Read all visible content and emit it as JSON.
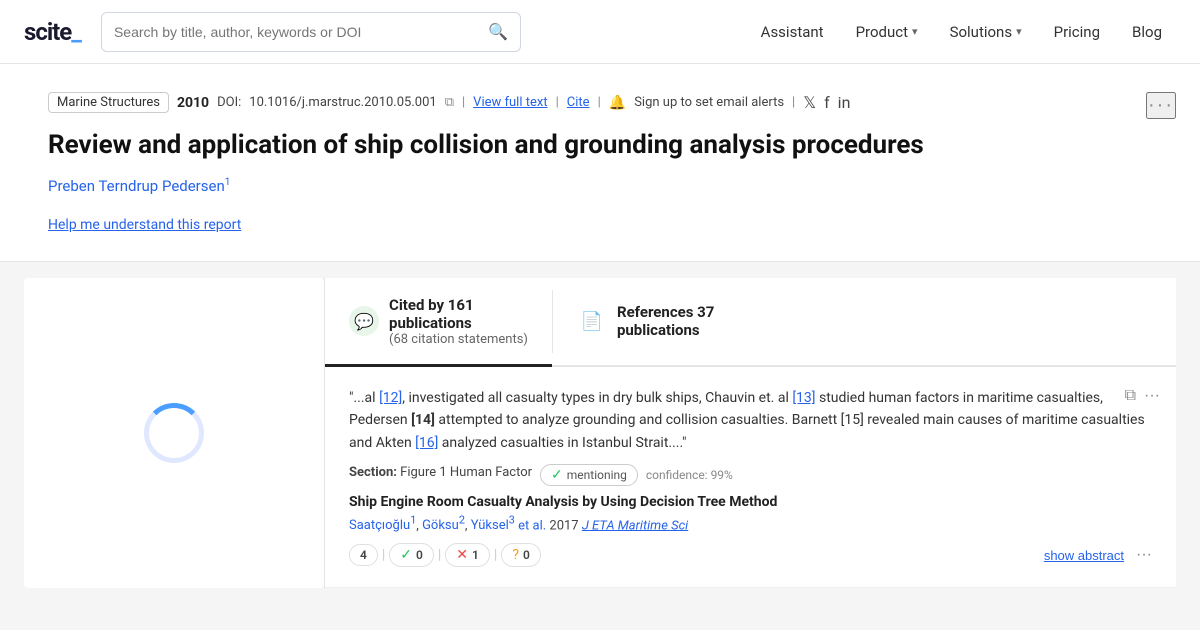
{
  "header": {
    "logo_text": "scite_",
    "search_placeholder": "Search by title, author, keywords or DOI",
    "nav_items": [
      {
        "label": "Assistant",
        "has_chevron": false
      },
      {
        "label": "Product",
        "has_chevron": true
      },
      {
        "label": "Solutions",
        "has_chevron": true
      },
      {
        "label": "Pricing",
        "has_chevron": false
      },
      {
        "label": "Blog",
        "has_chevron": false
      }
    ]
  },
  "article": {
    "journal": "Marine Structures",
    "year": "2010",
    "doi_label": "DOI:",
    "doi_value": "10.1016/j.marstruc.2010.05.001",
    "view_full_text": "View full text",
    "cite": "Cite",
    "signup_text": "Sign up to set email alerts",
    "title": "Review and application of ship collision and grounding analysis procedures",
    "author": "Preben Terndrup Pedersen",
    "author_superscript": "1",
    "help_link": "Help me understand this report",
    "more_label": "···"
  },
  "tabs": [
    {
      "id": "cited",
      "icon": "💬",
      "count": "Cited by 161",
      "label": "publications",
      "sub": "(68 citation statements)",
      "active": true
    },
    {
      "id": "references",
      "icon": "📄",
      "count": "References 37",
      "label": "publications",
      "sub": "",
      "active": false
    }
  ],
  "citation_card": {
    "text": "\"...al [12], investigated all casualty types in dry bulk ships, Chauvin et. al [13] studied human factors in maritime casualties, Pedersen [14] attempted to analyze grounding and collision casualties. Barnett [15] revealed main causes of maritime casualties and Akten [16] analyzed casualties in Istanbul Strait....\"",
    "refs": [
      "[12]",
      "[13]",
      "[14]",
      "[15]",
      "[16]"
    ],
    "section_label": "Section:",
    "section_value": "Figure 1 Human Factor",
    "mention_type": "mentioning",
    "confidence_label": "confidence:",
    "confidence_value": "99%",
    "paper_title": "Ship Engine Room Casualty Analysis by Using Decision Tree Method",
    "authors": [
      {
        "name": "Saatçıoğlu",
        "superscript": "1"
      },
      {
        "name": "Göksu",
        "superscript": "2"
      },
      {
        "name": "Yüksel",
        "superscript": "3"
      }
    ],
    "et_al": "et al.",
    "year": "2017",
    "journal": "J ETA Maritime Sci",
    "show_abstract": "show abstract",
    "badges": [
      {
        "icon": "check",
        "count": "4"
      },
      {
        "icon": "check-green",
        "count": "0"
      },
      {
        "icon": "x-red",
        "count": "1"
      },
      {
        "icon": "q-yellow",
        "count": "0"
      }
    ],
    "more_label": "···"
  }
}
